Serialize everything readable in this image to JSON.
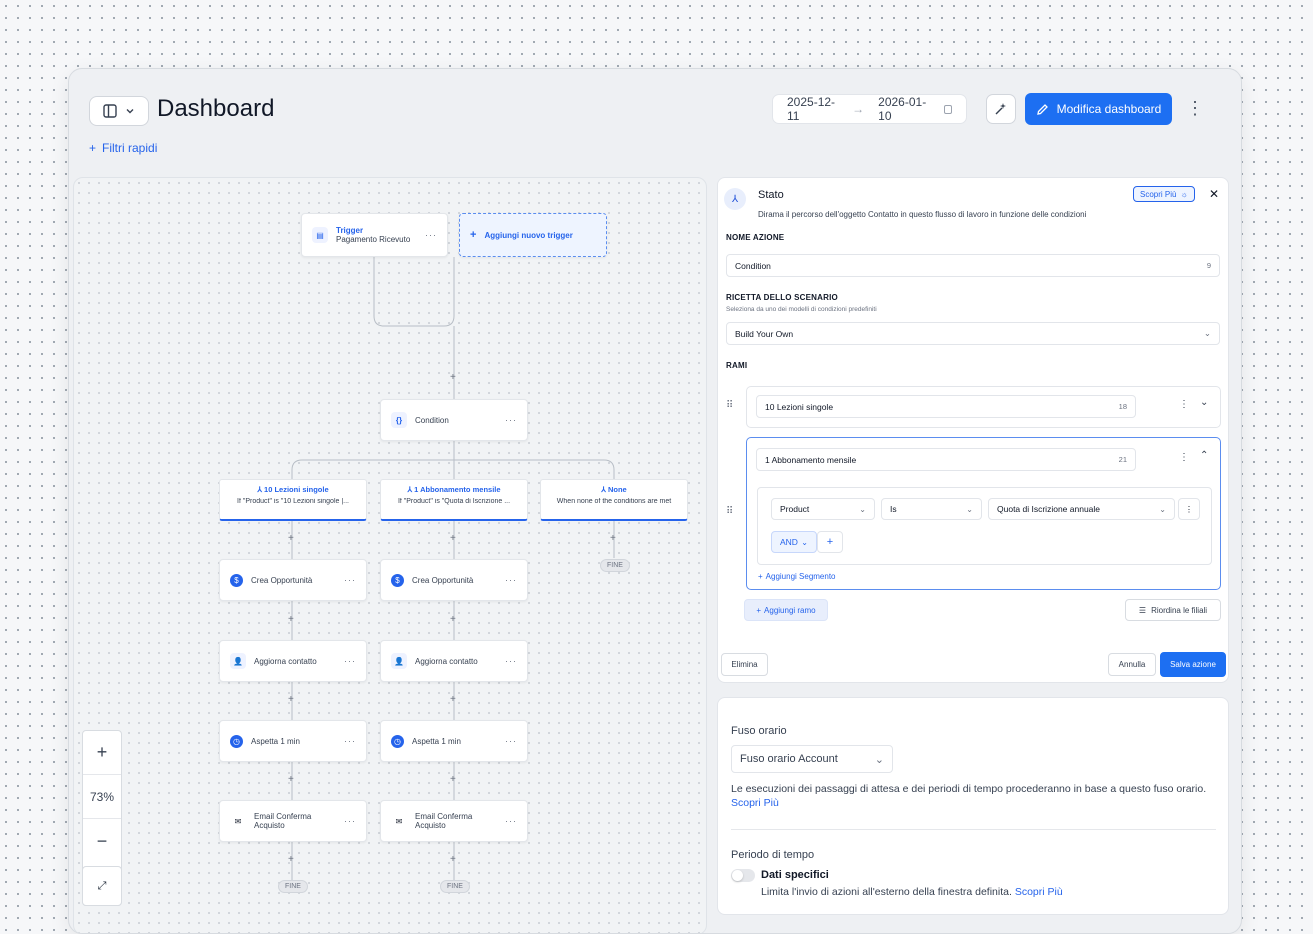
{
  "header": {
    "title": "Dashboard",
    "filters_label": "Filtri rapidi",
    "date_start": "2025-12-11",
    "date_end": "2026-01-10",
    "edit_label": "Modifica dashboard"
  },
  "flow": {
    "trigger_label": "Trigger",
    "trigger_value": "Pagamento Ricevuto",
    "add_trigger": "Aggiungi nuovo trigger",
    "condition": "Condition",
    "branches": [
      {
        "title": "10 Lezioni singole",
        "sub": "If \"Product\" is \"10 Lezioni singole |..."
      },
      {
        "title": "1 Abbonamento mensile",
        "sub": "If \"Product\" is \"Quota di Iscrizione ..."
      },
      {
        "title": "None",
        "sub": "When none of the conditions are met"
      }
    ],
    "steps": [
      "Crea Opportunità",
      "Aggiorna contatto",
      "Aspetta 1 min",
      "Email Conferma Acquisto"
    ],
    "end": "FINE",
    "zoom": "73%"
  },
  "panel": {
    "title": "Stato",
    "description": "Dirama il percorso dell'oggetto Contatto in questo flusso di lavoro in funzione delle condizioni",
    "learn_more": "Scopri Più",
    "action_name_label": "NOME AZIONE",
    "action_name": "Condition",
    "action_name_count": "9",
    "recipe_label": "RICETTA DELLO SCENARIO",
    "recipe_hint": "Seleziona da uno dei modelli di condizioni predefiniti",
    "recipe_value": "Build Your Own",
    "branches_label": "RAMI",
    "branch1": "10 Lezioni singole",
    "branch1_count": "18",
    "branch2": "1 Abbonamento mensile",
    "branch2_count": "21",
    "cond_field": "Product",
    "cond_op": "Is",
    "cond_value": "Quota di Iscrizione annuale",
    "cond_and": "AND",
    "add_segment": "Aggiungi Segmento",
    "add_branch": "Aggiungi ramo",
    "reorder": "Riordina le filiali",
    "delete": "Elimina",
    "cancel": "Annulla",
    "save": "Salva azione"
  },
  "settings": {
    "tz_label": "Fuso orario",
    "tz_value": "Fuso orario Account",
    "tz_desc": "Le esecuzioni dei passaggi di attesa e dei periodi di tempo procederanno in base a questo fuso orario.",
    "tz_link": "Scopri Più",
    "period_label": "Periodo di tempo",
    "specific_label": "Dati specifici",
    "specific_desc": "Limita l'invio di azioni all'esterno della finestra definita.",
    "specific_link": "Scopri Più"
  }
}
